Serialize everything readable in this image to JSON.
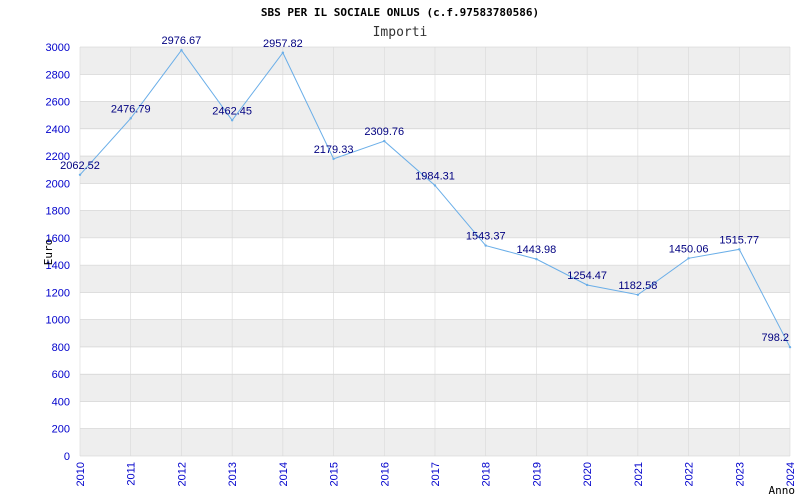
{
  "chart_data": {
    "type": "line",
    "title": "SBS PER IL SOCIALE ONLUS (c.f.97583780586)",
    "subtitle": "Importi",
    "ylabel": "Euro",
    "xlabel": "Anno",
    "ylim": [
      0,
      3000
    ],
    "yticks": [
      0,
      200,
      400,
      600,
      800,
      1000,
      1200,
      1400,
      1600,
      1800,
      2000,
      2200,
      2400,
      2600,
      2800,
      3000
    ],
    "categories": [
      "2010",
      "2011",
      "2012",
      "2013",
      "2014",
      "2015",
      "2016",
      "2017",
      "2018",
      "2019",
      "2020",
      "2021",
      "2022",
      "2023",
      "2024"
    ],
    "series": [
      {
        "values": [
          2062.52,
          2476.79,
          2976.67,
          2462.45,
          2957.82,
          2179.33,
          2309.76,
          1984.31,
          1543.37,
          1443.98,
          1254.47,
          1182.58,
          1450.06,
          1515.77,
          798.2
        ],
        "labels": [
          "2062.52",
          "2476.79",
          "2976.67",
          "2462.45",
          "2957.82",
          "2179.33",
          "2309.76",
          "1984.31",
          "1543.37",
          "1443.98",
          "1254.47",
          "1182.58",
          "1450.06",
          "1515.77",
          "798.2"
        ]
      }
    ],
    "grid": true,
    "legend": "none",
    "colors": {
      "line": "#6aaee8",
      "axis_text": "#0000cc",
      "label_text": "#000080",
      "band": "#eeeeee",
      "gridline": "#cccccc"
    }
  }
}
